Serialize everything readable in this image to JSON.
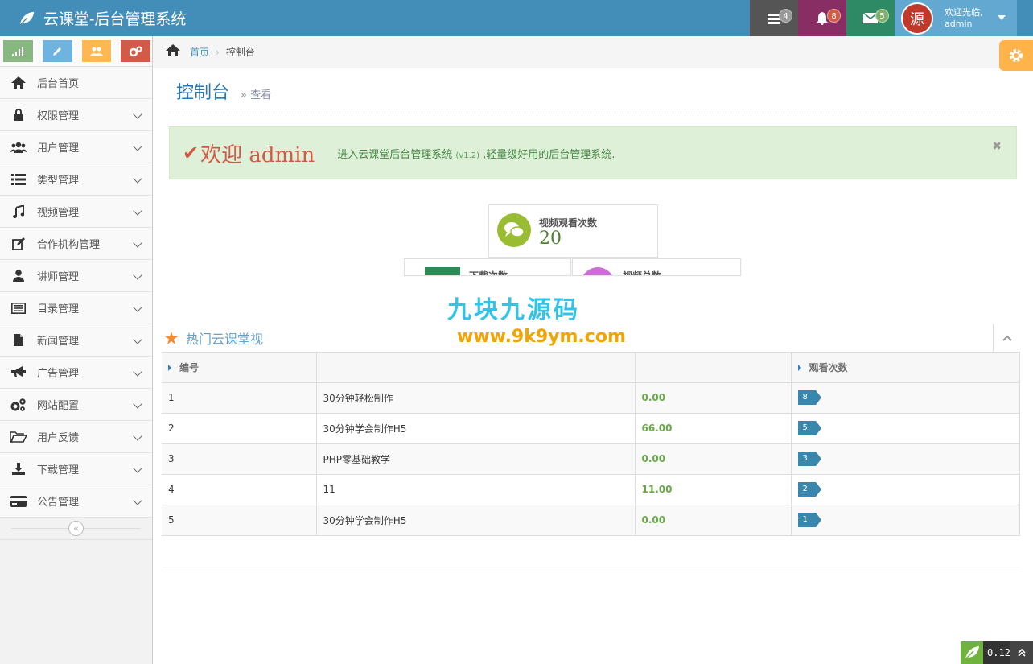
{
  "brand": {
    "title": "云课堂-后台管理系统"
  },
  "navbar": {
    "tasks_count": "4",
    "notifications_count": "8",
    "messages_count": "5",
    "avatar_text": "源",
    "welcome_line": "欢迎光临,",
    "username": "admin"
  },
  "sidebar": {
    "items": [
      {
        "label": "后台首页",
        "icon": "home-icon"
      },
      {
        "label": "权限管理",
        "icon": "lock-icon"
      },
      {
        "label": "用户管理",
        "icon": "users-icon"
      },
      {
        "label": "类型管理",
        "icon": "list-icon"
      },
      {
        "label": "视频管理",
        "icon": "music-icon"
      },
      {
        "label": "合作机构管理",
        "icon": "edit-icon"
      },
      {
        "label": "讲师管理",
        "icon": "user-icon"
      },
      {
        "label": "目录管理",
        "icon": "list-alt-icon"
      },
      {
        "label": "新闻管理",
        "icon": "file-icon"
      },
      {
        "label": "广告管理",
        "icon": "bullhorn-icon"
      },
      {
        "label": "网站配置",
        "icon": "cogs-icon"
      },
      {
        "label": "用户反馈",
        "icon": "folder-open-icon"
      },
      {
        "label": "下载管理",
        "icon": "download-icon"
      },
      {
        "label": "公告管理",
        "icon": "credit-card-icon"
      }
    ],
    "collapse_glyph": "«"
  },
  "breadcrumb": {
    "home": "首页",
    "sep": "›",
    "current": "控制台"
  },
  "page_header": {
    "title": "控制台",
    "subtitle": "» 查看"
  },
  "alert": {
    "check": "✔",
    "welcome": "欢迎 admin",
    "desc_prefix": "进入云课堂后台管理系统",
    "version": "(v1.2)",
    "desc_suffix": ",轻量级好用的后台管理系统.",
    "close": "✖"
  },
  "infoboxes": [
    {
      "label": "视频观看次数",
      "value": "20"
    },
    {
      "label": "下载次数",
      "value": ""
    },
    {
      "label": "视频总数",
      "value": ""
    }
  ],
  "watermark": {
    "cn": "九块九源码",
    "url": "www.9k9ym.com"
  },
  "widget": {
    "title": "热门云课堂视",
    "columns": [
      "编号",
      "",
      "",
      "观看次数"
    ],
    "rows": [
      {
        "id": "1",
        "name": "30分钟轻松制作",
        "price": "0.00",
        "views": "8"
      },
      {
        "id": "2",
        "name": "30分钟学会制作H5",
        "price": "66.00",
        "views": "5"
      },
      {
        "id": "3",
        "name": "PHP零基础教学",
        "price": "0.00",
        "views": "3"
      },
      {
        "id": "4",
        "name": "11",
        "price": "11.00",
        "views": "2"
      },
      {
        "id": "5",
        "name": "30分钟学会制作H5",
        "price": "0.00",
        "views": "1"
      }
    ]
  },
  "footer": {
    "time": "0.12"
  },
  "colors": {
    "navbar": "#438eb9",
    "accent_blue": "#2679b5",
    "alert_bg": "#dff0d8",
    "welcome_red": "#d15b47",
    "price_green": "#69aa46",
    "tag_blue": "#3a87ad"
  }
}
